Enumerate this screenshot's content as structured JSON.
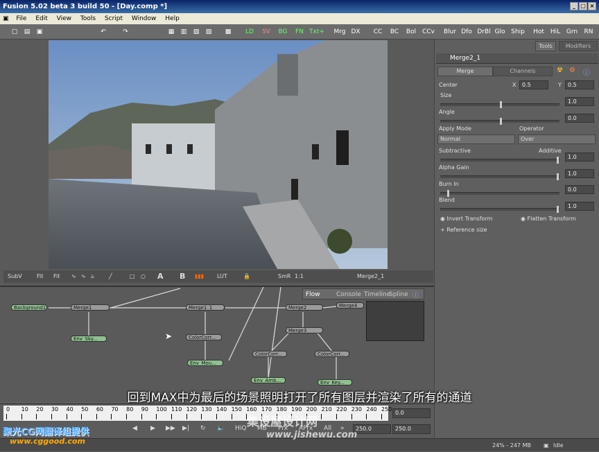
{
  "window": {
    "title": "Fusion 5.02 beta 3 build 50 - [Day.comp *]"
  },
  "menu": [
    "File",
    "Edit",
    "View",
    "Tools",
    "Script",
    "Window",
    "Help"
  ],
  "toolbar": {
    "buttons": [
      "LD",
      "SV",
      "BG",
      "FN",
      "Txt+",
      "Mrg",
      "DX",
      "CC",
      "BC",
      "Bol",
      "CCv",
      "Blur",
      "Dfo",
      "DrBl",
      "Glo",
      "Ship",
      "Hot",
      "HiL",
      "Grn",
      "RN"
    ]
  },
  "viewer": {
    "toolbar": [
      "SubV",
      "Fit",
      "Fit",
      "LUT",
      "SmR",
      "1:1"
    ],
    "node_name": "Merge2_1",
    "channels": [
      "A",
      "B"
    ]
  },
  "rightpanel": {
    "tabs": [
      "Tools",
      "Modifiers"
    ],
    "node_title": "Merge2_1",
    "subtabs": [
      "Merge",
      "Channels"
    ],
    "center": {
      "label": "Center",
      "x_label": "X",
      "x": "0.5",
      "y_label": "Y",
      "y": "0.5"
    },
    "size": {
      "label": "Size",
      "value": "1.0"
    },
    "angle": {
      "label": "Angle",
      "value": "0.0"
    },
    "apply_mode": {
      "label": "Apply Mode",
      "value": "Normal"
    },
    "operator": {
      "label": "Operator",
      "value": "Over"
    },
    "subtractive_label": "Subtractive",
    "additive_label": "Additive",
    "additive_value": "1.0",
    "alpha_gain": {
      "label": "Alpha Gain",
      "value": "1.0"
    },
    "burn_in": {
      "label": "Burn In",
      "value": "0.0"
    },
    "blend": {
      "label": "Blend",
      "value": "1.0"
    },
    "invert_transform": "Invert Transform",
    "flatten_transform": "Flatten Transform",
    "reference_size": "Reference size"
  },
  "flow": {
    "tabs": [
      "Flow",
      "Console",
      "Timeline",
      "Spline"
    ],
    "nodes": {
      "background": "Background1",
      "merge1": "Merge1",
      "merge1_1": "Merge1_1",
      "merge2": "Merge2",
      "merge4": "Merge4",
      "merge3": "Merge3",
      "env_sky": "Env_Sky...",
      "colorcorr1": "ColorCorr...",
      "env_mou": "Env_Mou...",
      "colorcorr2": "ColorCorr...",
      "colorcorr3": "ColorCorr...",
      "env_amb": "Env_Amb...",
      "env_key": "Env_Key..."
    }
  },
  "subtitle": "回到MAX中为最后的场景照明打开了所有图层并渲染了所有的通道",
  "timeline": {
    "ticks": [
      "0",
      "10",
      "20",
      "30",
      "40",
      "50",
      "60",
      "70",
      "80",
      "90",
      "100",
      "110",
      "120",
      "130",
      "140",
      "150",
      "160",
      "170",
      "180",
      "190",
      "200",
      "210",
      "220",
      "230",
      "240",
      "250"
    ],
    "current_time": "0.0",
    "render_end": "250.0",
    "end": "250.0",
    "buttons": [
      "HiQ",
      "MB",
      "Prx",
      "APrx",
      "All"
    ]
  },
  "status": {
    "memory": "24% - 247 MB",
    "state": "Idle"
  },
  "watermarks": {
    "left": "聚光CG网翻译组提供",
    "left_url": "www.cggood.com",
    "center": "集设屋设计网",
    "center_url": "www.jishewu.com"
  }
}
